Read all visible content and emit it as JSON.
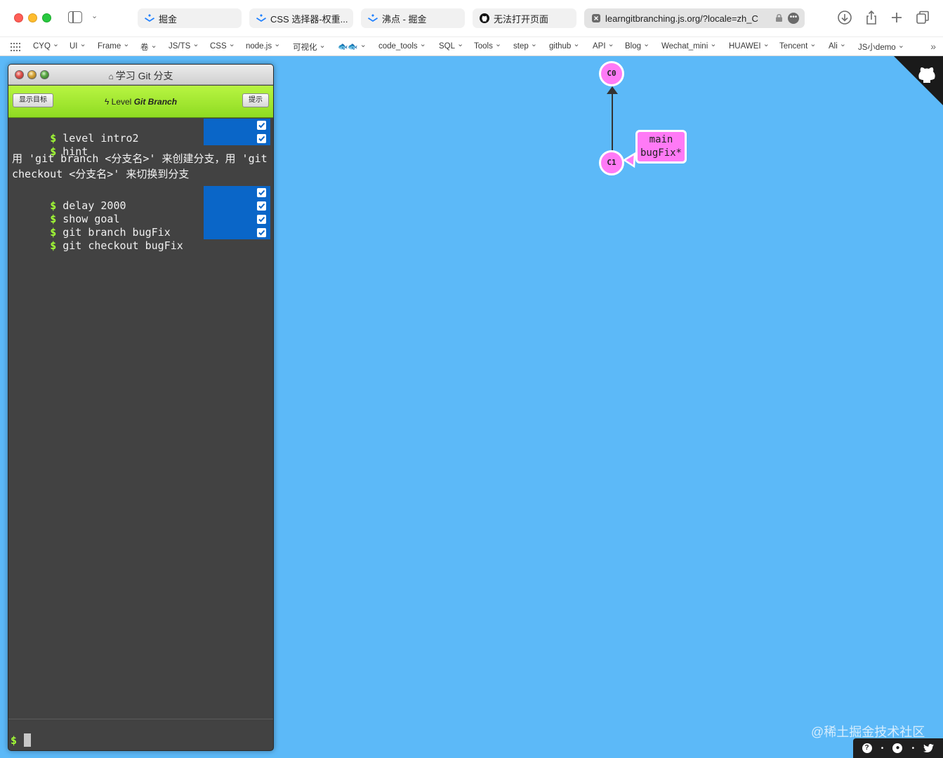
{
  "browser": {
    "tabs": [
      {
        "label": "掘金",
        "icon": "juejin-icon"
      },
      {
        "label": "CSS 选择器-权重...",
        "icon": "juejin-icon"
      },
      {
        "label": "沸点 - 掘金",
        "icon": "juejin-icon"
      },
      {
        "label": "无法打开页面",
        "icon": "github-icon"
      },
      {
        "label": "learngitbranching.js.org/?locale=zh_C",
        "icon": "close-tab-icon"
      }
    ],
    "bookmarks": [
      "CYQ",
      "UI",
      "Frame",
      "卷",
      "JS/TS",
      "CSS",
      "node.js",
      "可视化",
      "🐟🐟",
      "code_tools",
      "SQL",
      "Tools",
      "step",
      "github",
      "API",
      "Blog",
      "Wechat_mini",
      "HUAWEI",
      "Tencent",
      "Ali",
      "JS小demo"
    ]
  },
  "window": {
    "title": "学习 Git 分支",
    "goal_button": "显示目标",
    "hint_button": "提示",
    "level_prefix": "Level",
    "level_name": "Git Branch"
  },
  "commands_top": [
    {
      "text": "level intro2"
    },
    {
      "text": "hint"
    }
  ],
  "hint_text": "用 'git branch <分支名>' 来创建分支，用 'git checkout <分支名>' 来切换到分支",
  "commands_bottom": [
    {
      "text": "delay 2000"
    },
    {
      "text": "show goal"
    },
    {
      "text": "git branch bugFix"
    },
    {
      "text": "git checkout bugFix"
    }
  ],
  "prompt": "$",
  "graph": {
    "commits": [
      "C0",
      "C1"
    ],
    "branches": [
      "main",
      "bugFix*"
    ]
  },
  "watermark": "@稀土掘金技术社区",
  "colors": {
    "background": "#5cb9f8",
    "commit": "#ff7af6",
    "level_bar": "#a6eb32",
    "done_marker": "#0a66c8",
    "prompt_dollar": "#a3ff35"
  }
}
